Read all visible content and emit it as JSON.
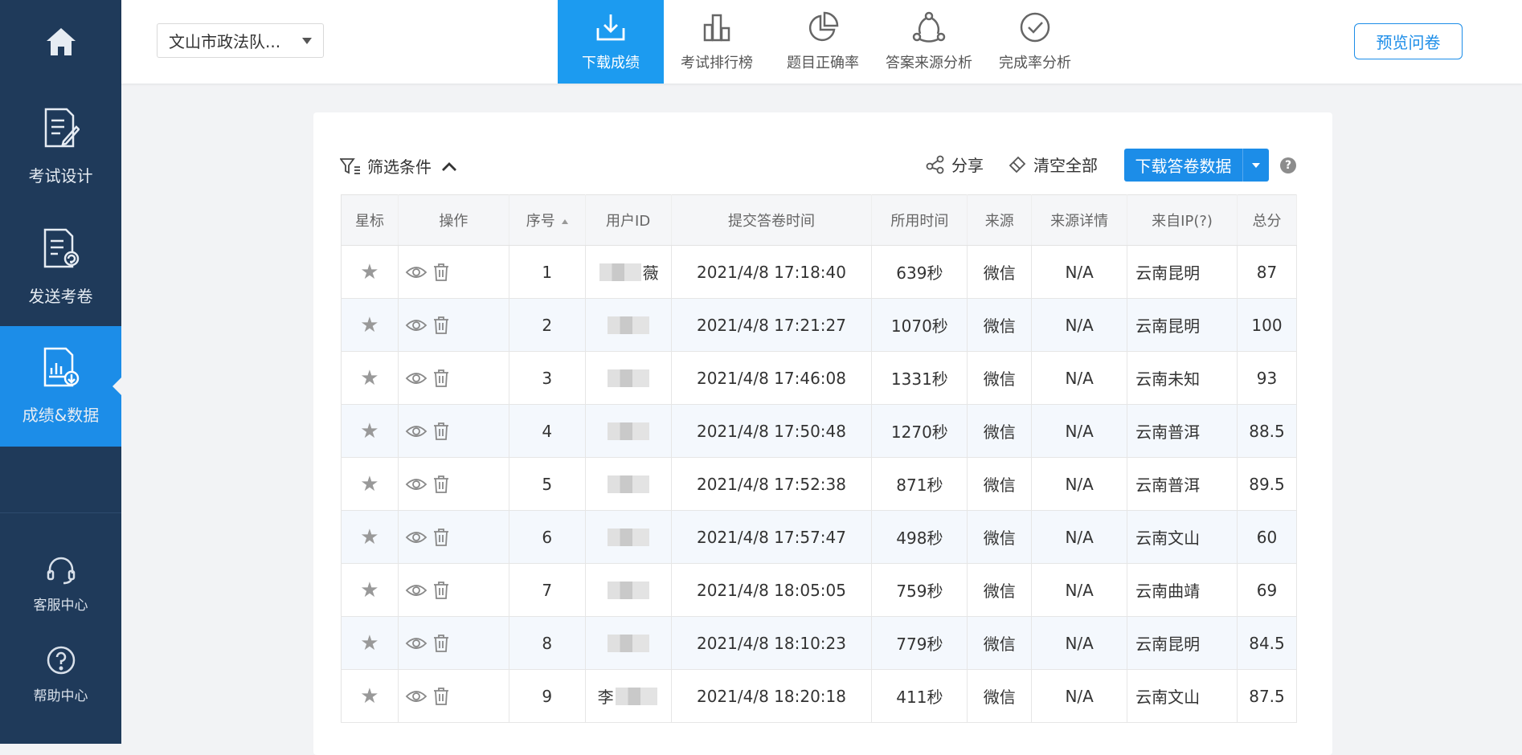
{
  "sidebar": {
    "items": [
      {
        "label": "考试设计",
        "icon": "document-edit-icon"
      },
      {
        "label": "发送考卷",
        "icon": "document-send-icon"
      },
      {
        "label": "成绩&数据",
        "icon": "document-chart-icon",
        "active": true
      }
    ],
    "bottom": [
      {
        "label": "客服中心",
        "icon": "headset-icon"
      },
      {
        "label": "帮助中心",
        "icon": "help-circle-icon"
      }
    ]
  },
  "header": {
    "survey_name": "文山市政法队...",
    "tabs": [
      {
        "label": "下载成绩",
        "icon": "download-icon",
        "active": true
      },
      {
        "label": "考试排行榜",
        "icon": "bar-chart-icon"
      },
      {
        "label": "题目正确率",
        "icon": "pie-chart-icon"
      },
      {
        "label": "答案来源分析",
        "icon": "share-nodes-icon"
      },
      {
        "label": "完成率分析",
        "icon": "check-circle-icon"
      }
    ],
    "preview_label": "预览问卷"
  },
  "toolbar": {
    "filter_label": "筛选条件",
    "share_label": "分享",
    "clear_label": "清空全部",
    "download_label": "下载答卷数据",
    "help_label": "?"
  },
  "table": {
    "columns": [
      "星标",
      "操作",
      "序号",
      "用户ID",
      "提交答卷时间",
      "所用时间",
      "来源",
      "来源详情",
      "来自IP(?)",
      "总分"
    ],
    "rows": [
      {
        "idx": "1",
        "uid_prefix": "",
        "uid_suffix": "薇",
        "time": "2021/4/8 17:18:40",
        "used": "639秒",
        "source": "微信",
        "detail": "N/A",
        "ip": "云南昆明",
        "score": "87"
      },
      {
        "idx": "2",
        "uid_prefix": "",
        "uid_suffix": "",
        "time": "2021/4/8 17:21:27",
        "used": "1070秒",
        "source": "微信",
        "detail": "N/A",
        "ip": "云南昆明",
        "score": "100"
      },
      {
        "idx": "3",
        "uid_prefix": "",
        "uid_suffix": "",
        "time": "2021/4/8 17:46:08",
        "used": "1331秒",
        "source": "微信",
        "detail": "N/A",
        "ip": "云南未知",
        "score": "93"
      },
      {
        "idx": "4",
        "uid_prefix": "",
        "uid_suffix": "",
        "time": "2021/4/8 17:50:48",
        "used": "1270秒",
        "source": "微信",
        "detail": "N/A",
        "ip": "云南普洱",
        "score": "88.5"
      },
      {
        "idx": "5",
        "uid_prefix": "",
        "uid_suffix": "",
        "time": "2021/4/8 17:52:38",
        "used": "871秒",
        "source": "微信",
        "detail": "N/A",
        "ip": "云南普洱",
        "score": "89.5"
      },
      {
        "idx": "6",
        "uid_prefix": "",
        "uid_suffix": "",
        "time": "2021/4/8 17:57:47",
        "used": "498秒",
        "source": "微信",
        "detail": "N/A",
        "ip": "云南文山",
        "score": "60"
      },
      {
        "idx": "7",
        "uid_prefix": "",
        "uid_suffix": "",
        "time": "2021/4/8 18:05:05",
        "used": "759秒",
        "source": "微信",
        "detail": "N/A",
        "ip": "云南曲靖",
        "score": "69"
      },
      {
        "idx": "8",
        "uid_prefix": "",
        "uid_suffix": "",
        "time": "2021/4/8 18:10:23",
        "used": "779秒",
        "source": "微信",
        "detail": "N/A",
        "ip": "云南昆明",
        "score": "84.5"
      },
      {
        "idx": "9",
        "uid_prefix": "李",
        "uid_suffix": "",
        "time": "2021/4/8 18:20:18",
        "used": "411秒",
        "source": "微信",
        "detail": "N/A",
        "ip": "云南文山",
        "score": "87.5"
      }
    ]
  },
  "colors": {
    "sidebar_bg": "#1f3a5a",
    "accent": "#1c8de8",
    "active_tab": "#1c9bf0"
  }
}
